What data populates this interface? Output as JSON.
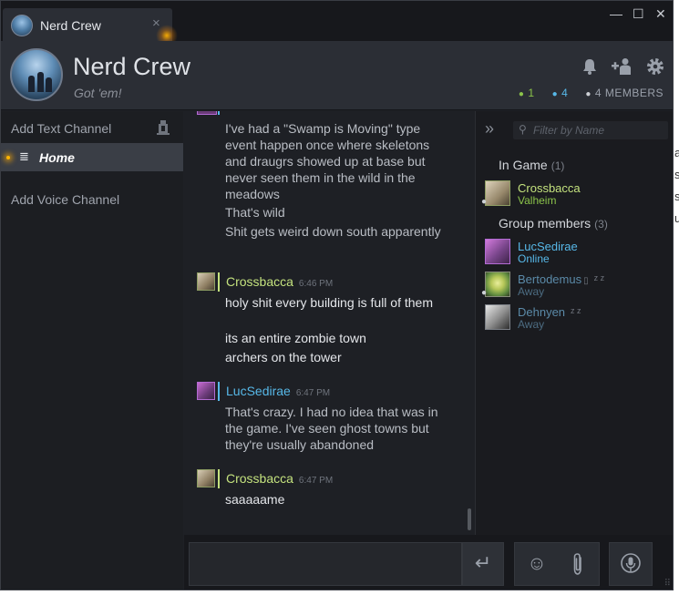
{
  "window": {
    "tab_title": "Nerd Crew",
    "tab_close": "×",
    "minimize": "—",
    "maximize": "☐",
    "close": "✕"
  },
  "header": {
    "group_name": "Nerd Crew",
    "tagline": "Got 'em!",
    "icons": [
      "bell-icon",
      "add-friend-icon",
      "gear-icon"
    ],
    "stats": {
      "in_game": "1",
      "online": "4",
      "members": "4 MEMBERS",
      "in_game_color": "#8bc34a",
      "online_color": "#57b8e8"
    }
  },
  "sidebar": {
    "add_text_channel": "Add Text Channel",
    "home": "Home",
    "add_voice_channel": "Add Voice Channel"
  },
  "chat": {
    "messages": [
      {
        "text": "I've had a \"Swamp is Moving\" type event happen once where skeletons and draugrs showed up at base but never seen them in the wild in the meadows"
      },
      {
        "text": "That's wild"
      },
      {
        "text": "Shit gets weird down south apparently"
      },
      {
        "author": "Crossbacca",
        "time": "6:46 PM",
        "author_color": "#c4e27e",
        "lines": [
          "holy shit every building is full of them",
          "its an entire zombie town",
          "archers on the tower"
        ]
      },
      {
        "author": "LucSedirae",
        "time": "6:47 PM",
        "author_color": "#57b8e8",
        "lines": [
          "That's crazy. I had no idea that was in the game. I've seen ghost towns but they're usually abandoned"
        ]
      },
      {
        "author": "Crossbacca",
        "time": "6:47 PM",
        "author_color": "#c4e27e",
        "lines": [
          "saaaaame"
        ]
      }
    ]
  },
  "members_panel": {
    "filter_placeholder": "Filter by Name",
    "in_game_title": "In Game",
    "in_game_count": "(1)",
    "group_title": "Group members",
    "group_count": "(3)",
    "in_game": [
      {
        "name": "Crossbacca",
        "status": "Valheim"
      }
    ],
    "group": [
      {
        "name": "LucSedirae",
        "status": "Online"
      },
      {
        "name": "Bertodemus",
        "status": "Away"
      },
      {
        "name": "Dehnyen",
        "status": "Away"
      }
    ]
  },
  "composer": {
    "send_icon": "↵",
    "emoji_icon": "☺",
    "attach_icon": "📎",
    "voice_icon": "🎙"
  }
}
